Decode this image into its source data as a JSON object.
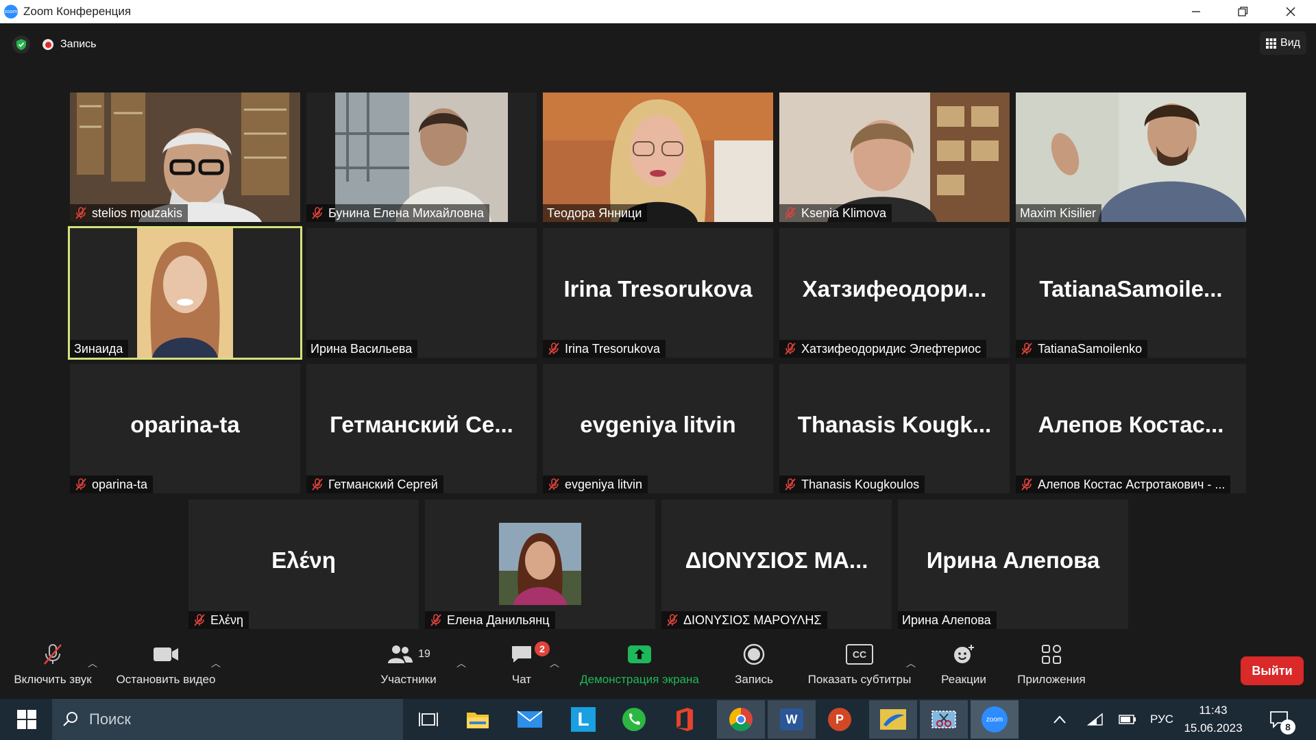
{
  "window": {
    "title": "Zoom Конференция",
    "logo_text": "zoom"
  },
  "topbar": {
    "record_label": "Запись",
    "view_label": "Вид"
  },
  "tiles": [
    {
      "name": "stelios mouzakis",
      "big": "",
      "muted": true,
      "video": true
    },
    {
      "name": "Бунина Елена Михайловна",
      "big": "",
      "muted": true,
      "video": true
    },
    {
      "name": "Теодора Янници",
      "big": "",
      "muted": false,
      "video": true
    },
    {
      "name": "Ksenia Klimova",
      "big": "",
      "muted": true,
      "video": true
    },
    {
      "name": "Maxim Kisilier",
      "big": "",
      "muted": false,
      "video": true
    },
    {
      "name": "Зинаида",
      "big": "",
      "muted": false,
      "video": true,
      "active": true
    },
    {
      "name": "Ирина Васильева",
      "big": "",
      "muted": false,
      "video": false
    },
    {
      "name": "Irina Tresorukova",
      "big": "Irina Tresorukova",
      "muted": true,
      "video": false
    },
    {
      "name": "Хатзифеодоридис Элефтериос",
      "big": "Хатзифеодори...",
      "muted": true,
      "video": false
    },
    {
      "name": "TatianaSamoilenko",
      "big": "TatianaSamoile...",
      "muted": true,
      "video": false
    },
    {
      "name": "oparina-ta",
      "big": "oparina-ta",
      "muted": true,
      "video": false
    },
    {
      "name": "Гетманский Сергей",
      "big": "Гетманский  Се...",
      "muted": true,
      "video": false
    },
    {
      "name": "evgeniya litvin",
      "big": "evgeniya litvin",
      "muted": true,
      "video": false
    },
    {
      "name": "Thanasis Kougkoulos",
      "big": "Thanasis  Kougk...",
      "muted": true,
      "video": false
    },
    {
      "name": "Алепов Костас Астротакович - ...",
      "big": "Алепов  Костас...",
      "muted": true,
      "video": false
    },
    {
      "name": "Ελένη",
      "big": "Ελένη",
      "muted": true,
      "video": false
    },
    {
      "name": "Елена Данильянц",
      "big": "",
      "muted": true,
      "video": false,
      "avatar": true
    },
    {
      "name": "ΔΙΟΝΥΣΙΟΣ ΜΑΡΟΥΛΗΣ",
      "big": "ΔΙΟΝΥΣΙΟΣ  ΜΑ...",
      "muted": true,
      "video": false
    },
    {
      "name": "Ирина Алепова",
      "big": "Ирина Алепова",
      "muted": false,
      "video": false
    }
  ],
  "toolbar": {
    "unmute": "Включить звук",
    "stop_video": "Остановить видео",
    "participants": "Участники",
    "participants_count": "19",
    "chat": "Чат",
    "chat_badge": "2",
    "share": "Демонстрация экрана",
    "record": "Запись",
    "captions": "Показать субтитры",
    "captions_icon": "CC",
    "reactions": "Реакции",
    "apps": "Приложения",
    "exit": "Выйти"
  },
  "taskbar": {
    "search_placeholder": "Поиск",
    "language": "РУС",
    "time": "11:43",
    "date": "15.06.2023",
    "notif_count": "8",
    "zoom_label": "zoom",
    "word_letter": "W",
    "launcher_letter": "L",
    "ppt_letter": "P"
  },
  "colors": {
    "share_green": "#1cb85a",
    "exit_red": "#d92929",
    "active_outline": "#d6e27a",
    "mute_red": "#e0433b"
  }
}
